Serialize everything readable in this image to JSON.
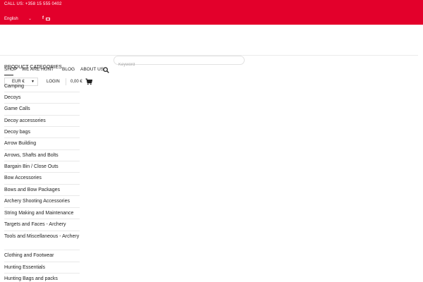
{
  "topbar": {
    "call_label": "CALL US: +358 15 555 0402",
    "language": "English",
    "social": {
      "facebook": "f"
    }
  },
  "search": {
    "placeholder": "Keyword"
  },
  "nav": {
    "shop": "SHOP",
    "we_are_hunt": "WE ARE HUNT",
    "blog": "BLOG",
    "about": "ABOUT US"
  },
  "categories_title": "PRODUCT CATEGORIES",
  "currency": {
    "selected": "EUR €"
  },
  "login": "LOGIN",
  "cart": {
    "total": "0,00 €"
  },
  "categories": [
    "Camping",
    "Decoys",
    "Game Calls",
    "Decoy accessories",
    "Decoy bags",
    "Arrow Building",
    "Arrows, Shafts and Bolts",
    "Bargain Bin / Close Outs",
    "Bow Accessories",
    "Bows and Bow Packages",
    "Archery Shooting Accessories",
    "String Making and Maintenance",
    "Targets and Faces - Archery",
    "Tools and Miscellaneous - Archery",
    "Clothing and Footwear",
    "Hunting Essentials",
    "Hunting Bags and packs"
  ],
  "colors": {
    "brand_red": "#e3002b"
  }
}
